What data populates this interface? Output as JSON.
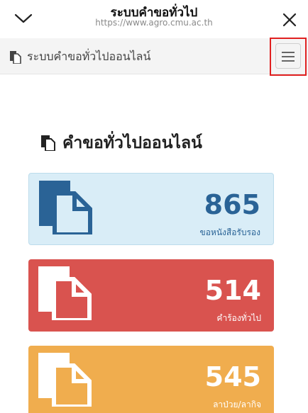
{
  "browser": {
    "title": "ระบบคำขอทั่วไป",
    "url": "https://www.agro.cmu.ac.th",
    "chevron_icon": "chevron-down-icon",
    "close_icon": "close-icon"
  },
  "navbar": {
    "brand": "ระบบคำขอทั่วไปออนไลน์",
    "brand_icon": "document-copy-icon",
    "menu_icon": "hamburger-menu-icon"
  },
  "section": {
    "title": "คำขอทั่วไปออนไลน์",
    "icon": "document-copy-icon"
  },
  "cards": [
    {
      "value": "865",
      "label": "ขอหนังสือรับรอง",
      "bg": "#d9edf7",
      "fg": "#2a6396"
    },
    {
      "value": "514",
      "label": "คำร้องทั่วไป",
      "bg": "#d9534f",
      "fg": "#ffffff"
    },
    {
      "value": "545",
      "label": "ลาป่วย/ลากิจ",
      "bg": "#f0ad4e",
      "fg": "#ffffff"
    }
  ]
}
